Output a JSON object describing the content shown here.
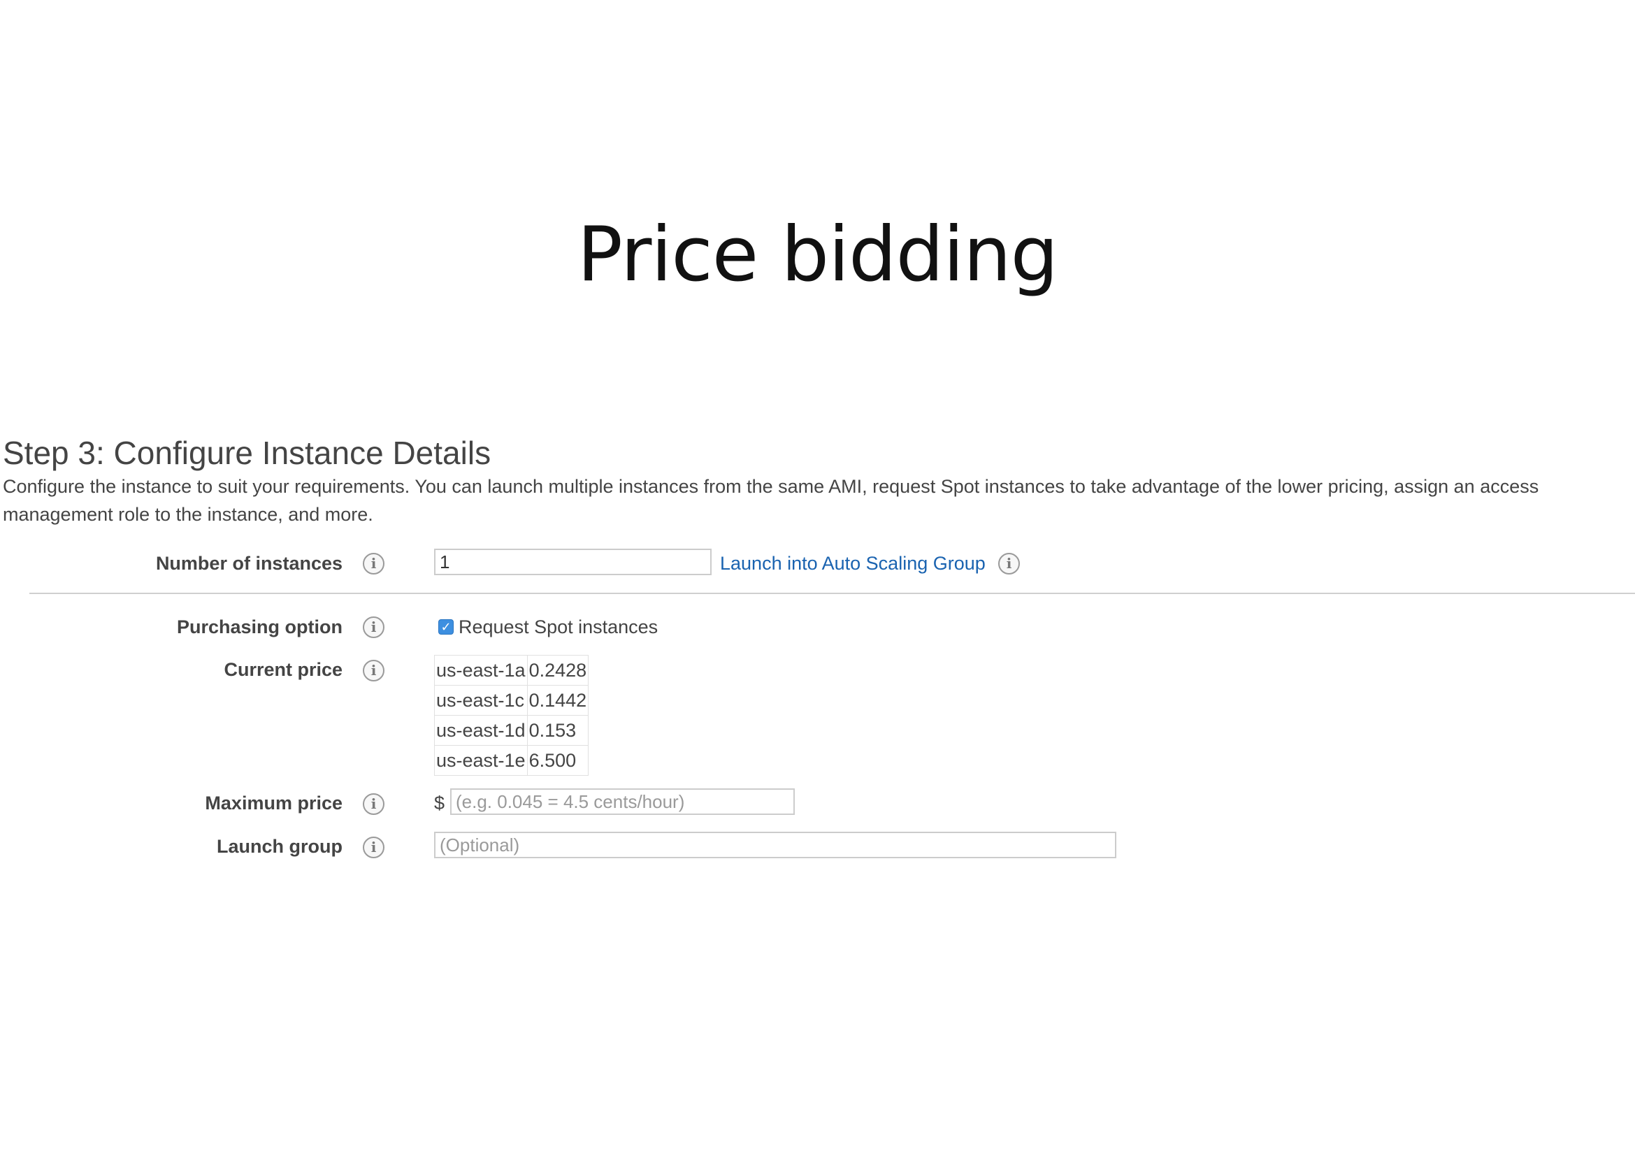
{
  "slide": {
    "title": "Price bidding"
  },
  "step": {
    "heading": "Step 3: Configure Instance Details",
    "description": "Configure the instance to suit your requirements. You can launch multiple instances from the same AMI, request Spot instances to take advantage of the lower pricing, assign an access management role to the instance, and more."
  },
  "form": {
    "number_of_instances": {
      "label": "Number of instances",
      "value": "1",
      "link": "Launch into Auto Scaling Group"
    },
    "purchasing_option": {
      "label": "Purchasing option",
      "checkbox_label": "Request Spot instances",
      "checked": true
    },
    "current_price": {
      "label": "Current price",
      "rows": [
        {
          "zone": "us-east-1a",
          "price": "0.2428"
        },
        {
          "zone": "us-east-1c",
          "price": "0.1442"
        },
        {
          "zone": "us-east-1d",
          "price": "0.153"
        },
        {
          "zone": "us-east-1e",
          "price": "6.500"
        }
      ]
    },
    "maximum_price": {
      "label": "Maximum price",
      "currency": "$",
      "placeholder": "(e.g. 0.045 = 4.5 cents/hour)"
    },
    "launch_group": {
      "label": "Launch group",
      "placeholder": "(Optional)"
    }
  },
  "icons": {
    "info": "info-icon",
    "info_glyph": "i",
    "check_glyph": "✓"
  },
  "colors": {
    "link": "#1a63b0",
    "checkbox": "#3d8fe0"
  }
}
